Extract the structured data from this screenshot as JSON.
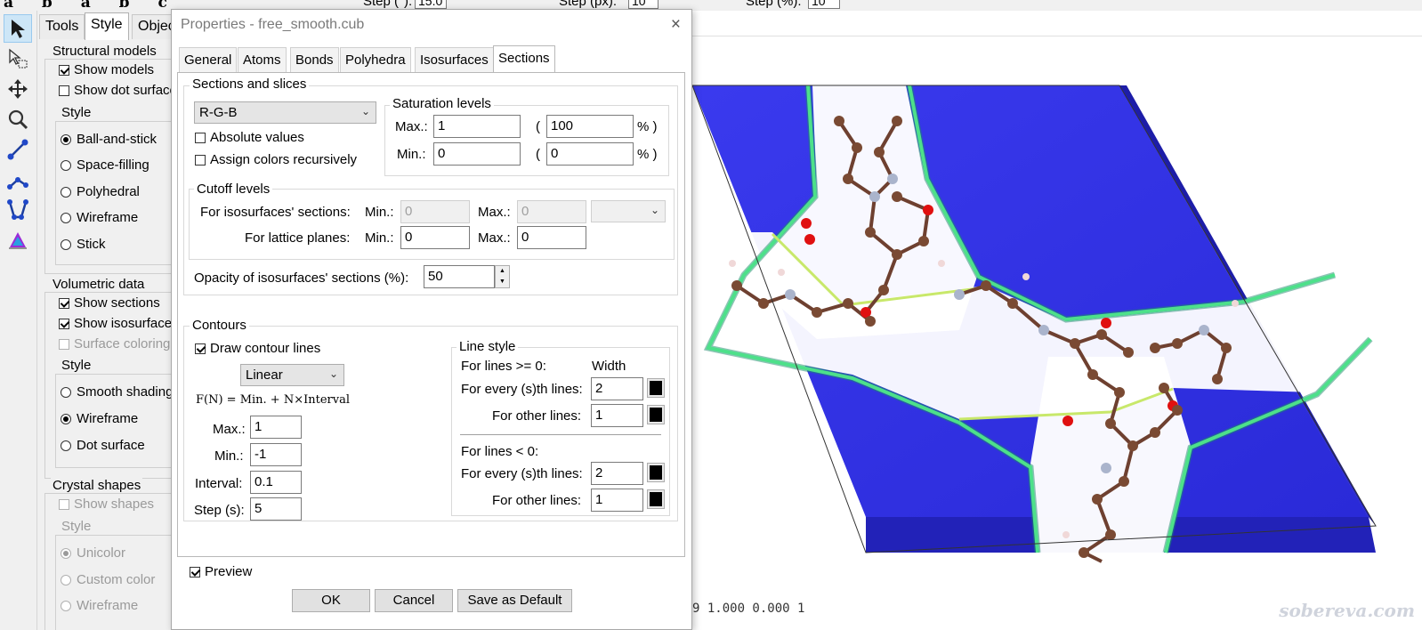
{
  "toolbar": {
    "letters": "a b a b c",
    "step_deg_label": "Step (°):",
    "step_deg_value": "15.0",
    "step_px_label": "Step (px):",
    "step_px_value": "10",
    "step_pct_label": "Step (%):",
    "step_pct_value": "10"
  },
  "left_panel": {
    "tabs": [
      "Tools",
      "Style",
      "Objects"
    ],
    "structural": {
      "title": "Structural models",
      "show_models": "Show models",
      "show_dot_surface": "Show dot surface",
      "style_title": "Style",
      "styles": [
        "Ball-and-stick",
        "Space-filling",
        "Polyhedral",
        "Wireframe",
        "Stick"
      ],
      "selected": "Ball-and-stick"
    },
    "volumetric": {
      "title": "Volumetric data",
      "show_sections": "Show sections",
      "show_isosurfaces": "Show isosurfaces",
      "surface_coloring": "Surface coloring",
      "style_title": "Style",
      "styles": [
        "Smooth shading",
        "Wireframe",
        "Dot surface"
      ],
      "selected": "Wireframe"
    },
    "crystal": {
      "title": "Crystal shapes",
      "show_shapes": "Show shapes",
      "style_title": "Style",
      "styles": [
        "Unicolor",
        "Custom color",
        "Wireframe"
      ],
      "selected": "Unicolor"
    }
  },
  "dialog": {
    "title": "Properties - free_smooth.cub",
    "close": "×",
    "tabs": [
      "General",
      "Atoms",
      "Bonds",
      "Polyhedra",
      "Isosurfaces",
      "Sections"
    ],
    "active_tab": "Sections",
    "sections": {
      "title": "Sections and slices",
      "color_scheme": "R-G-B",
      "absolute_values": "Absolute values",
      "assign_recursively": "Assign colors recursively",
      "saturation": {
        "title": "Saturation levels",
        "max_label": "Max.:",
        "max_value": "1",
        "max_pct": "100",
        "min_label": "Min.:",
        "min_value": "0",
        "min_pct": "0",
        "open_paren": "(",
        "pct_suffix": "% )"
      },
      "cutoff": {
        "title": "Cutoff levels",
        "iso_label": "For isosurfaces' sections:",
        "lattice_label": "For lattice planes:",
        "min_label": "Min.:",
        "max_label": "Max.:",
        "iso_min": "0",
        "iso_max": "0",
        "lat_min": "0",
        "lat_max": "0"
      },
      "opacity_label": "Opacity of isosurfaces' sections (%):",
      "opacity_value": "50"
    },
    "contours": {
      "title": "Contours",
      "draw_lines": "Draw contour lines",
      "mode": "Linear",
      "formula": "F(N) = Min. + N×Interval",
      "max_label": "Max.:",
      "max_value": "1",
      "min_label": "Min.:",
      "min_value": "-1",
      "interval_label": "Interval:",
      "interval_value": "0.1",
      "step_label": "Step (s):",
      "step_value": "5",
      "line_style": {
        "title": "Line style",
        "pos_label": "For lines >= 0:",
        "width_header": "Width",
        "every_label": "For every (s)th lines:",
        "other_label": "For other lines:",
        "pos_every": "2",
        "pos_other": "1",
        "neg_label": "For lines < 0:",
        "neg_every": "2",
        "neg_other": "1"
      }
    },
    "preview": "Preview",
    "buttons": {
      "ok": "OK",
      "cancel": "Cancel",
      "save_default": "Save as Default"
    }
  },
  "status_numbers": "9    1.000    0.000    1",
  "watermark": "sobereva.com",
  "colors": {
    "slab": "#3333e6",
    "carbon": "#7a4a33",
    "oxygen": "#e01010",
    "nitrogen": "#aab4cc",
    "hydrogen": "#f0d8d8"
  }
}
